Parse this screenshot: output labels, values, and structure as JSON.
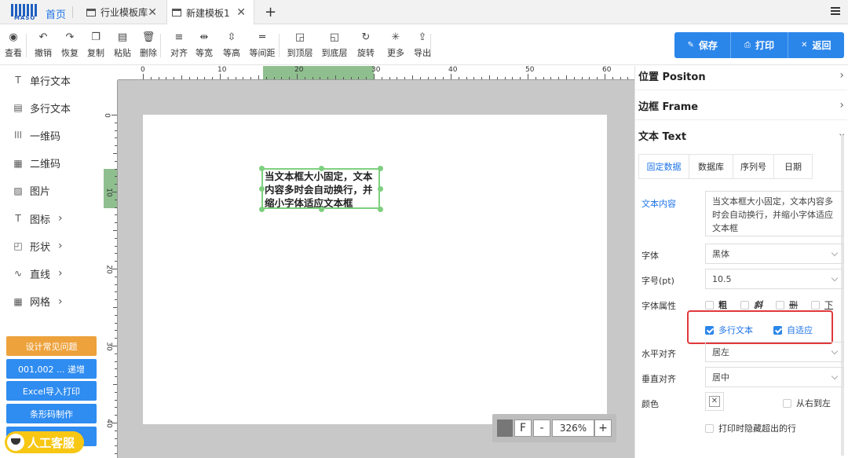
{
  "tabs": {
    "logo_text": "MASO",
    "home": "首页",
    "items": [
      {
        "label": "行业模板库",
        "close": "✕"
      },
      {
        "label": "新建模板1",
        "close": "✕"
      }
    ],
    "add": "+"
  },
  "toolbar": {
    "items": [
      {
        "label": "查看",
        "icon": "eye-icon"
      },
      {
        "label": "撤销",
        "icon": "undo-icon"
      },
      {
        "label": "恢复",
        "icon": "redo-icon"
      },
      {
        "label": "复制",
        "icon": "copy-icon"
      },
      {
        "label": "粘贴",
        "icon": "paste-icon"
      },
      {
        "label": "删除",
        "icon": "trash-icon"
      },
      {
        "label": "对齐",
        "icon": "align-icon"
      },
      {
        "label": "等宽",
        "icon": "equal-width-icon"
      },
      {
        "label": "等高",
        "icon": "equal-height-icon"
      },
      {
        "label": "等间距",
        "icon": "equal-spacing-icon"
      },
      {
        "label": "到顶层",
        "icon": "bring-front-icon"
      },
      {
        "label": "到底层",
        "icon": "send-back-icon"
      },
      {
        "label": "旋转",
        "icon": "rotate-icon"
      },
      {
        "label": "更多",
        "icon": "more-icon"
      },
      {
        "label": "导出",
        "icon": "export-icon"
      }
    ],
    "actions": {
      "save": "保存",
      "print": "打印",
      "back": "返回"
    }
  },
  "left_panel": {
    "tools": [
      {
        "label": "单行文本",
        "icon": "text-icon",
        "has_arrow": false
      },
      {
        "label": "多行文本",
        "icon": "multiline-text-icon",
        "has_arrow": false
      },
      {
        "label": "一维码",
        "icon": "barcode-icon",
        "has_arrow": false
      },
      {
        "label": "二维码",
        "icon": "qrcode-icon",
        "has_arrow": false
      },
      {
        "label": "图片",
        "icon": "image-icon",
        "has_arrow": false
      },
      {
        "label": "图标",
        "icon": "icon-tool-icon",
        "has_arrow": true
      },
      {
        "label": "形状",
        "icon": "shape-icon",
        "has_arrow": true
      },
      {
        "label": "直线",
        "icon": "line-icon",
        "has_arrow": true
      },
      {
        "label": "网格",
        "icon": "grid-icon",
        "has_arrow": true
      }
    ],
    "buttons": [
      "设计常见问题",
      "001,002 ... 递增",
      "Excel导入打印",
      "条形码制作"
    ],
    "service": "人工客服"
  },
  "canvas": {
    "ruler_h_labels": [
      "0",
      "10",
      "20",
      "30",
      "40",
      "50",
      "60"
    ],
    "ruler_v_labels": [
      "0",
      "10",
      "20",
      "30",
      "40"
    ],
    "text_content": "当文本框大小固定，文本内容多时会自动换行，并缩小字体适应文本框",
    "zoom": {
      "f_label": "F",
      "minus": "-",
      "value": "326%",
      "plus": "+"
    }
  },
  "right_panel": {
    "sections": {
      "position": "位置 Positon",
      "frame": "边框 Frame",
      "text": "文本 Text"
    },
    "subtabs": [
      "固定数据",
      "数据库",
      "序列号",
      "日期"
    ],
    "fields": {
      "content_label": "文本内容",
      "content_value": "当文本框大小固定，文本内容多时会自动换行，并缩小字体适应文本框",
      "font_label": "字体",
      "font_value": "黑体",
      "size_label": "字号(pt)",
      "size_value": "10.5",
      "attr_label": "字体属性",
      "attr_bold": "粗",
      "attr_italic": "斜",
      "attr_strike": "删",
      "attr_under": "下",
      "multiline": "多行文本",
      "autofit": "自适应",
      "halign_label": "水平对齐",
      "halign_value": "居左",
      "valign_label": "垂直对齐",
      "valign_value": "居中",
      "color_label": "颜色",
      "rtl": "从右到左",
      "hide_overflow": "打印时隐藏超出的行"
    }
  }
}
